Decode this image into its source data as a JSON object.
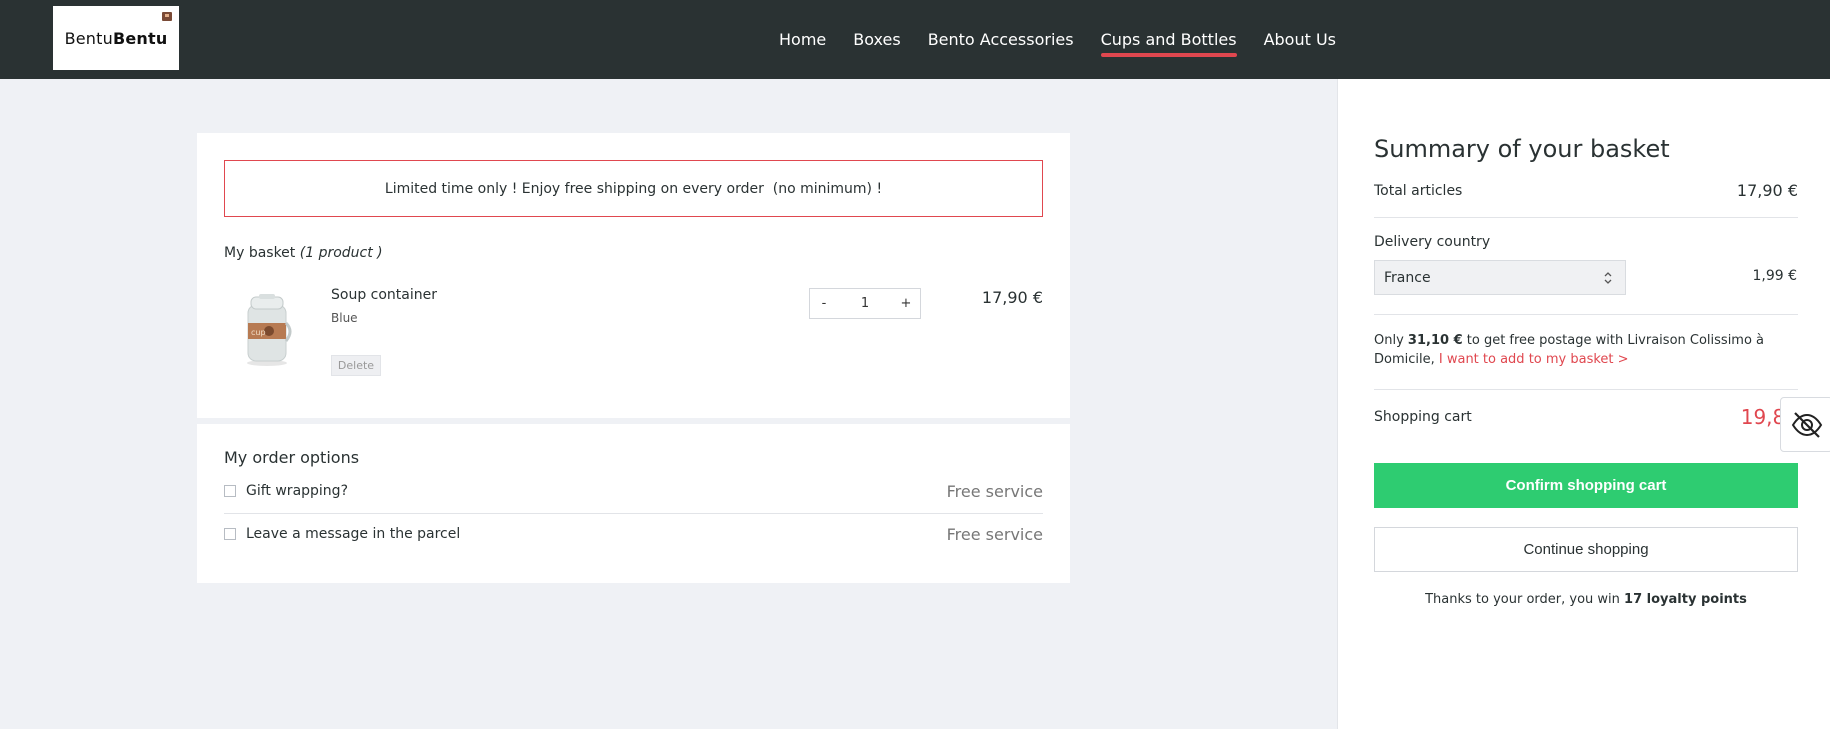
{
  "header": {
    "logo": {
      "part1": "Bentu",
      "part2": "Bentu"
    },
    "nav": [
      {
        "label": "Home",
        "active": false
      },
      {
        "label": "Boxes",
        "active": false
      },
      {
        "label": "Bento Accessories",
        "active": false
      },
      {
        "label": "Cups and Bottles",
        "active": true
      },
      {
        "label": "About Us",
        "active": false
      }
    ]
  },
  "promo": "Limited time only ! Enjoy free shipping on every order  (no minimum) !",
  "basket": {
    "title": "My basket",
    "count": "(1 product )",
    "product": {
      "name": "Soup container",
      "variant": "Blue",
      "delete_label": "Delete",
      "qty_minus": "-",
      "qty": "1",
      "qty_plus": "+",
      "price": "17,90 €"
    }
  },
  "options": {
    "title": "My order options",
    "items": [
      {
        "label": "Gift wrapping?",
        "price": "Free service"
      },
      {
        "label": "Leave a message in the parcel",
        "price": "Free service"
      }
    ]
  },
  "summary": {
    "title": "Summary of your basket",
    "total_articles_label": "Total articles",
    "total_articles_value": "17,90 €",
    "delivery_country_label": "Delivery country",
    "country": "France",
    "delivery_price": "1,99 €",
    "free_postage": {
      "prefix": "Only ",
      "amount": "31,10 €",
      "middle": " to get free postage with Livraison Colissimo à Domicile, ",
      "link": "I want to add to my basket >"
    },
    "cart_label": "Shopping cart",
    "cart_value": "19,89",
    "confirm_label": "Confirm shopping cart",
    "continue_label": "Continue shopping",
    "loyalty": {
      "prefix": "Thanks to your order, you win ",
      "points": "17 loyalty points"
    }
  },
  "colors": {
    "accent": "#e0474f",
    "confirm": "#2ecc71",
    "header": "#2a3233",
    "background": "#eff1f5"
  },
  "icons": [
    "eye-slash-icon",
    "select-chevrons-icon",
    "checkbox-icon"
  ]
}
